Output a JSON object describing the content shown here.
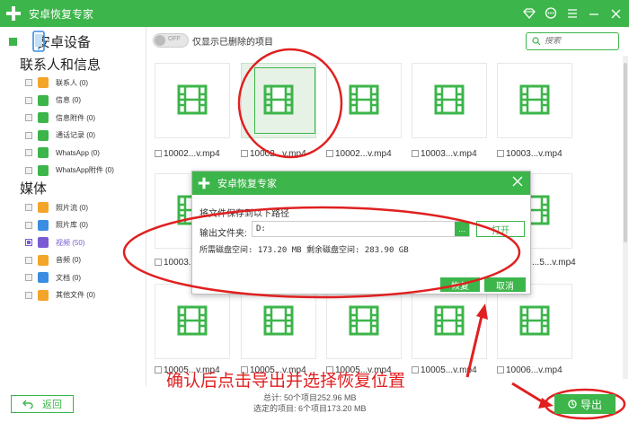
{
  "app": {
    "title": "安卓恢复专家",
    "accent_color": "#3cb54a",
    "window_controls": [
      "diamond-icon",
      "chat-icon",
      "menu-icon",
      "minimize-icon",
      "close-icon"
    ]
  },
  "sidebar": {
    "device": "安卓设备",
    "section_contacts": "联系人和信息",
    "contacts_items": [
      {
        "label": "联系人 (0)",
        "icon": "contact-icon",
        "color": "#f3a52a"
      },
      {
        "label": "信息 (0)",
        "icon": "message-icon",
        "color": "#3cb54a"
      },
      {
        "label": "信息附件 (0)",
        "icon": "attachment-icon",
        "color": "#3cb54a"
      },
      {
        "label": "通话记录 (0)",
        "icon": "phone-icon",
        "color": "#3cb54a"
      },
      {
        "label": "WhatsApp (0)",
        "icon": "whatsapp-icon",
        "color": "#3cb54a"
      },
      {
        "label": "WhatsApp附件 (0)",
        "icon": "whatsapp-attachment-icon",
        "color": "#3cb54a"
      }
    ],
    "section_media": "媒体",
    "media_items": [
      {
        "label": "照片流 (0)",
        "icon": "photostream-icon",
        "color": "#f3a52a"
      },
      {
        "label": "照片库 (0)",
        "icon": "photo-library-icon",
        "color": "#3a8de0"
      },
      {
        "label": "视频 (50)",
        "icon": "video-icon",
        "color": "#7a5bd4"
      },
      {
        "label": "音频 (0)",
        "icon": "audio-icon",
        "color": "#f3a52a"
      },
      {
        "label": "文档 (0)",
        "icon": "document-icon",
        "color": "#3a8de0"
      },
      {
        "label": "其他文件 (0)",
        "icon": "other-files-icon",
        "color": "#f3a52a"
      }
    ]
  },
  "toolbar": {
    "toggle_state": "OFF",
    "toggle_label": "仅显示已删除的项目",
    "search_placeholder": "搜索"
  },
  "files": {
    "row1": [
      "10002...v.mp4",
      "10002...v.mp4",
      "10002...v.mp4",
      "10003...v.mp4",
      "10003...v.mp4"
    ],
    "row2": [
      "10003...",
      "...5...v.mp4"
    ],
    "row3": [
      "10005...v.mp4",
      "10005...v.mp4",
      "10005...v.mp4",
      "10005...v.mp4",
      "10006...v.mp4"
    ]
  },
  "dialog": {
    "title": "安卓恢复专家",
    "save_prompt": "将文件保存到以下路径",
    "path_label": "输出文件夹:",
    "path_value": "D:",
    "dots": "...",
    "open_label": "打开",
    "space_text": "所需磁盘空间:  173.20 MB  剩余磁盘空间:  283.90 GB",
    "restore_label": "恢复",
    "cancel_label": "取消"
  },
  "annotation": {
    "text": "确认后点击导出并选择恢复位置"
  },
  "footer": {
    "back_label": "返回",
    "total": "总计: 50个项目252.96 MB",
    "selected": "选定的项目: 6个项目173.20 MB",
    "export_label": "导出"
  }
}
